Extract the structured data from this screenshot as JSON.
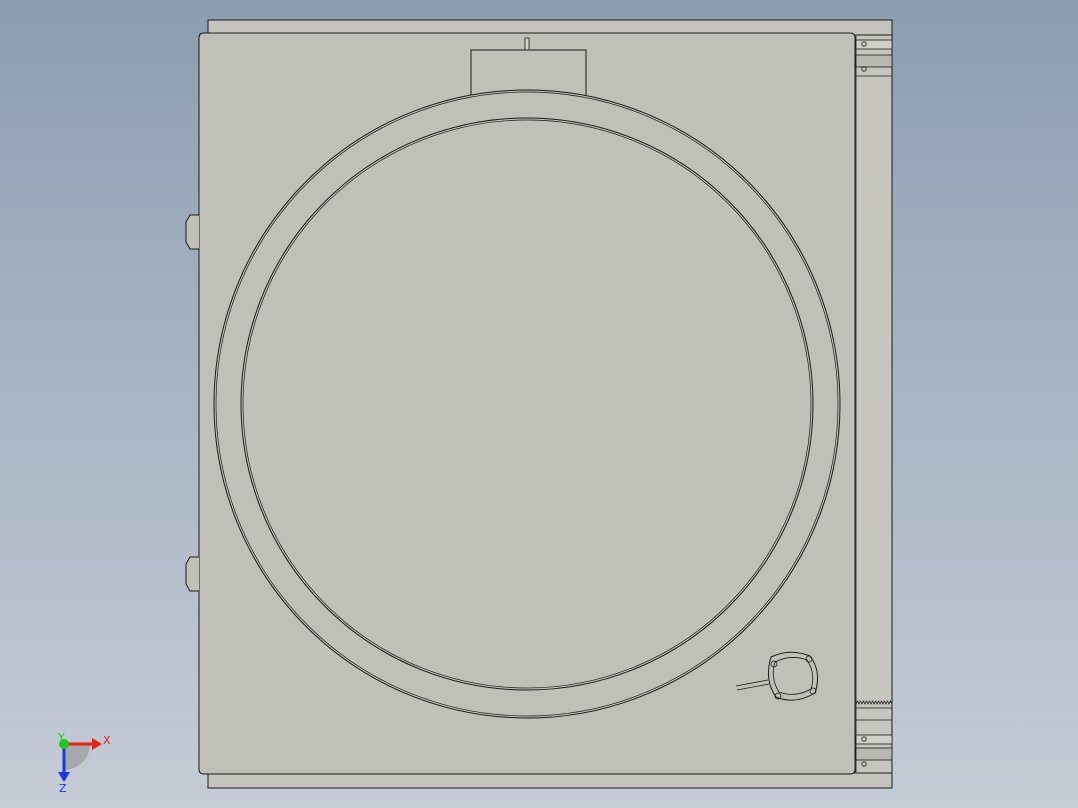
{
  "colors": {
    "background_top": "#8c9db1",
    "background_bottom": "#c6ccd6",
    "part_face": "#c0c0b8",
    "part_outline": "#1a1a1a",
    "axis_x": "#e8201a",
    "axis_y": "#1ec81e",
    "axis_z": "#1a3ad8"
  },
  "triad": {
    "x_label": "X",
    "y_label": "Y",
    "z_label": "Z"
  }
}
